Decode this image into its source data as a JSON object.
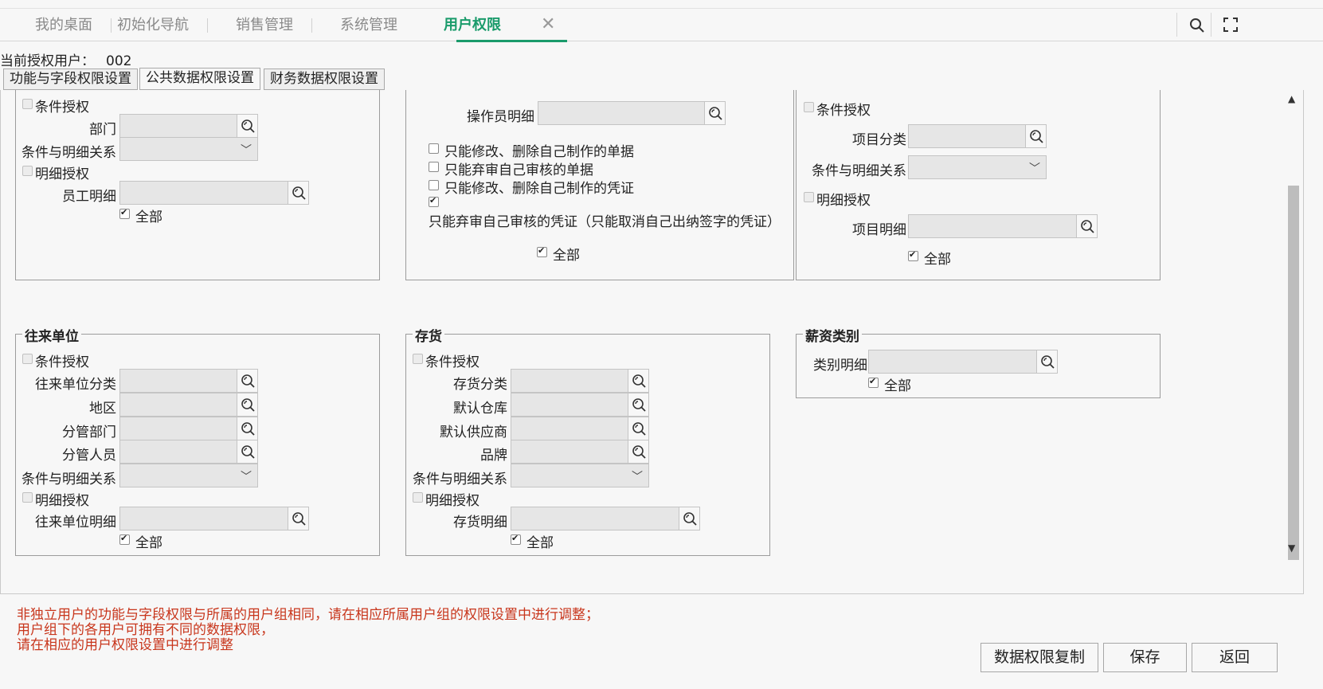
{
  "top_tabs": [
    "我的桌面",
    "初始化导航",
    "销售管理",
    "系统管理",
    "用户权限"
  ],
  "tab_close": "✕",
  "user": {
    "label": "当前授权用户：",
    "value": "002"
  },
  "sub_tabs": [
    "功能与字段权限设置",
    "公共数据权限设置",
    "财务数据权限设置"
  ],
  "dept_box": {
    "cond_auth": "条件授权",
    "dept_label": "部门",
    "relation_label": "条件与明细关系",
    "detail_auth": "明细授权",
    "staff_label": "员工明细",
    "all_label": "全部"
  },
  "operator_box": {
    "operator_label": "操作员明细",
    "options": [
      "只能修改、删除自己制作的单据",
      "只能弃审自己审核的单据",
      "只能修改、删除自己制作的凭证"
    ],
    "long_option": "只能弃审自己审核的凭证（只能取消自己出纳签字的凭证）",
    "all_label": "全部"
  },
  "project_box": {
    "cond_auth": "条件授权",
    "category_label": "项目分类",
    "relation_label": "条件与明细关系",
    "detail_auth": "明细授权",
    "detail_label": "项目明细",
    "all_label": "全部"
  },
  "partner_box": {
    "title": "往来单位",
    "cond_auth": "条件授权",
    "fields": [
      "往来单位分类",
      "地区",
      "分管部门",
      "分管人员"
    ],
    "relation_label": "条件与明细关系",
    "detail_auth": "明细授权",
    "detail_label": "往来单位明细",
    "all_label": "全部"
  },
  "inventory_box": {
    "title": "存货",
    "cond_auth": "条件授权",
    "fields": [
      "存货分类",
      "默认仓库",
      "默认供应商",
      "品牌"
    ],
    "relation_label": "条件与明细关系",
    "detail_auth": "明细授权",
    "detail_label": "存货明细",
    "all_label": "全部"
  },
  "salary_box": {
    "title": "薪资类别",
    "detail_label": "类别明细",
    "all_label": "全部"
  },
  "notes": [
    "非独立用户的功能与字段权限与所属的用户组相同，请在相应所属用户组的权限设置中进行调整；",
    "用户组下的各用户可拥有不同的数据权限，",
    "请在相应的用户权限设置中进行调整"
  ],
  "buttons": {
    "copy": "数据权限复制",
    "save": "保存",
    "back": "返回"
  },
  "colors": {
    "accent": "#1a9b6b",
    "note": "#c8361c"
  }
}
